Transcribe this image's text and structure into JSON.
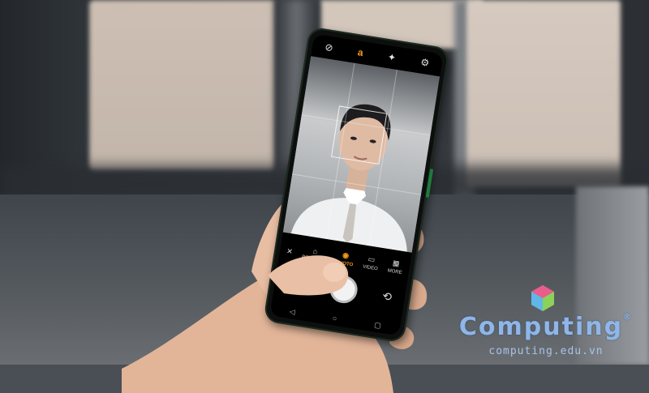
{
  "camera": {
    "top_icons": [
      "flash-off-icon",
      "ai-beauty-icon",
      "filter-icon",
      "settings-icon"
    ],
    "top_glyphs": [
      "⊘",
      "a",
      "✦",
      "⚙"
    ],
    "modes": [
      {
        "label": "",
        "icon": "✕"
      },
      {
        "label": "PORTRAIT",
        "icon": "⌂"
      },
      {
        "label": "PHOTO",
        "icon": "◉"
      },
      {
        "label": "VIDEO",
        "icon": "▭"
      },
      {
        "label": "MORE",
        "icon": "▦"
      }
    ],
    "active_mode_index": 2,
    "accent_color": "#f59a1c",
    "gridlines": true
  },
  "watermark": {
    "brand": "Computing",
    "registered": "®",
    "domain": "computing.edu.vn"
  }
}
